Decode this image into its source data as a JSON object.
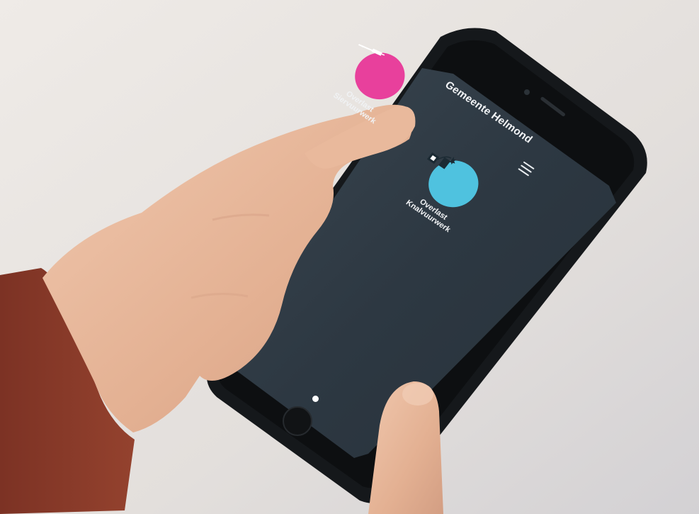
{
  "app": {
    "header_title": "Gemeente Helmond"
  },
  "tiles": [
    {
      "line1": "Overlast",
      "line2": "Siervuurwerk",
      "color": "#e8409c",
      "icon": "firework-stick-icon"
    },
    {
      "line1": "Overlast",
      "line2": "Knalvuurwerk",
      "color": "#4fc2df",
      "icon": "firecracker-icon"
    }
  ],
  "colors": {
    "screen": "#2e3a44",
    "phone_case": "#15181b",
    "sweater": "#8a3b2a",
    "skin": "#e6b79d"
  },
  "icons": {
    "menu": "hamburger-menu-icon",
    "page_indicator": "page-dot-indicator"
  }
}
